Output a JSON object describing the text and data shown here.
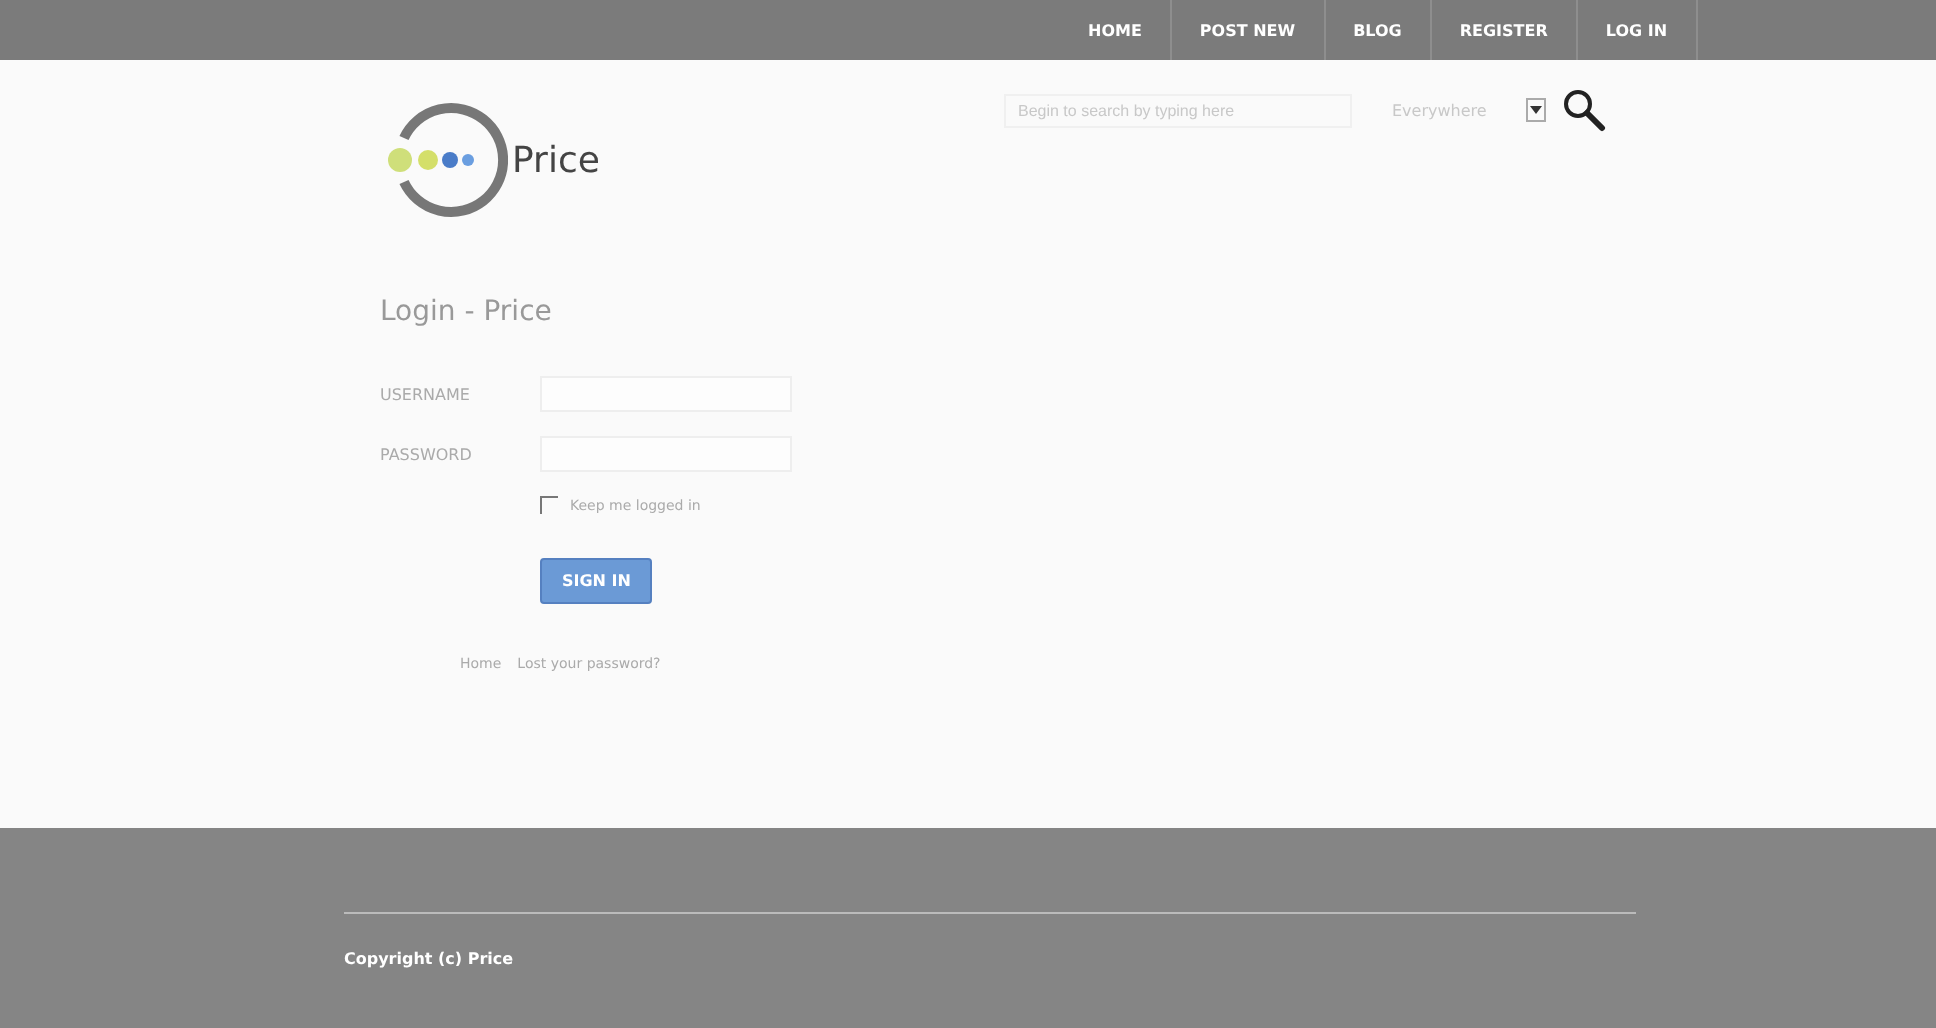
{
  "nav": [
    {
      "label": "HOME"
    },
    {
      "label": "POST NEW"
    },
    {
      "label": "BLOG"
    },
    {
      "label": "REGISTER"
    },
    {
      "label": "LOG IN"
    }
  ],
  "search": {
    "placeholder": "Begin to search by typing here",
    "scope": "Everywhere"
  },
  "logo": {
    "name": "Price"
  },
  "login": {
    "title": "Login - Price",
    "fields": [
      {
        "label": "USERNAME"
      },
      {
        "label": "PASSWORD"
      }
    ],
    "remember": {
      "label": "Keep me logged in",
      "checked": false
    },
    "submit": "SIGN IN",
    "links": [
      "Home",
      "Lost your password?"
    ]
  },
  "footer": {
    "copyright": "Copyright (c) Price"
  }
}
